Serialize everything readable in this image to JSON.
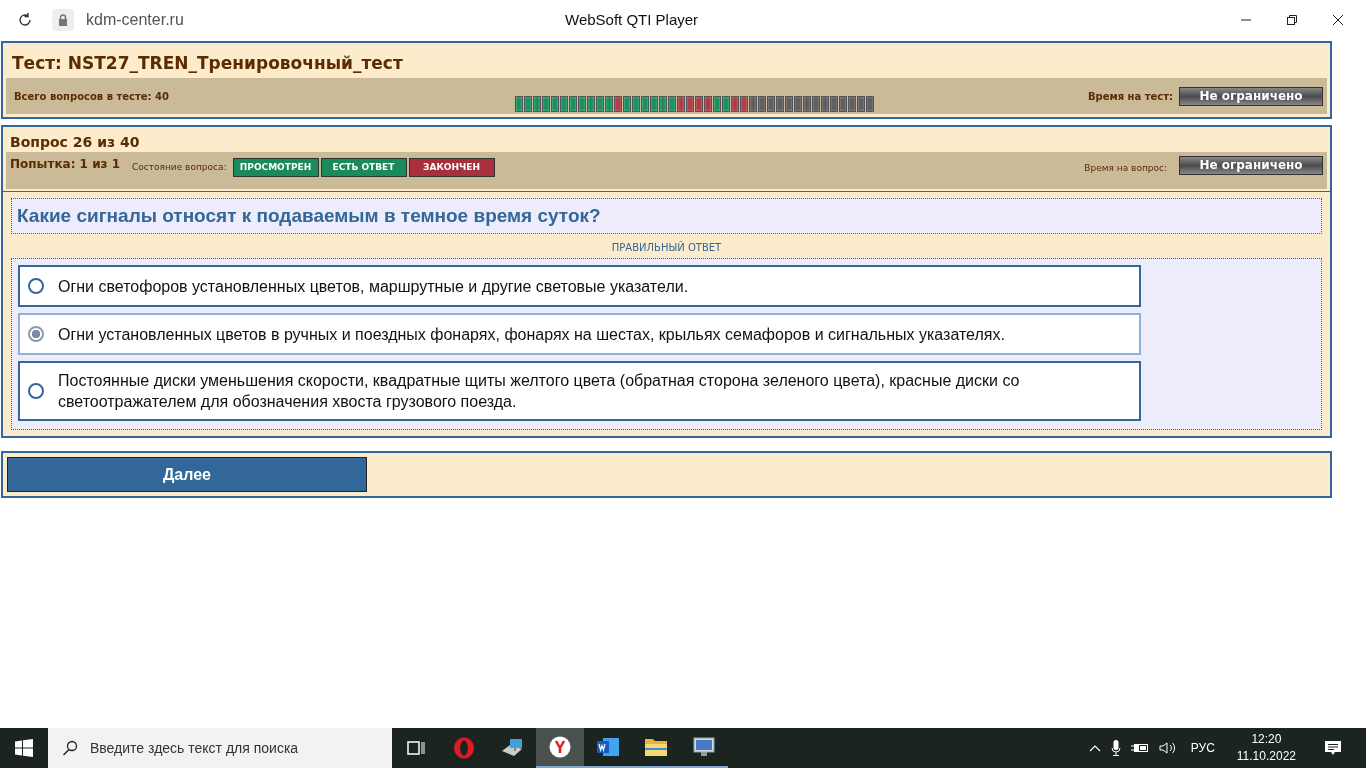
{
  "browser": {
    "url": "kdm-center.ru",
    "title": "WebSoft QTI Player"
  },
  "test": {
    "title": "Тест: NST27_TREN_Тренировочный_тест",
    "total_label": "Всего вопросов в тесте: 40",
    "time_label": "Время на тест:",
    "time_value": "Не ограничено",
    "progress": [
      {
        "color": "#17925f"
      },
      {
        "color": "#17925f"
      },
      {
        "color": "#17925f"
      },
      {
        "color": "#17925f"
      },
      {
        "color": "#17925f"
      },
      {
        "color": "#17925f"
      },
      {
        "color": "#17925f"
      },
      {
        "color": "#17925f"
      },
      {
        "color": "#17925f"
      },
      {
        "color": "#17925f"
      },
      {
        "color": "#17925f"
      },
      {
        "color": "#b03a45"
      },
      {
        "color": "#17925f"
      },
      {
        "color": "#17925f"
      },
      {
        "color": "#17925f"
      },
      {
        "color": "#17925f"
      },
      {
        "color": "#17925f"
      },
      {
        "color": "#17925f"
      },
      {
        "color": "#b03a45"
      },
      {
        "color": "#b03a45"
      },
      {
        "color": "#b03a45"
      },
      {
        "color": "#b03a45"
      },
      {
        "color": "#17925f"
      },
      {
        "color": "#17925f"
      },
      {
        "color": "#b03a45"
      },
      {
        "color": "#b03a45"
      },
      {
        "color": "#5e5e5e"
      },
      {
        "color": "#5e5e5e"
      },
      {
        "color": "#5e5e5e"
      },
      {
        "color": "#5e5e5e"
      },
      {
        "color": "#5e5e5e"
      },
      {
        "color": "#5e5e5e"
      },
      {
        "color": "#5e5e5e"
      },
      {
        "color": "#5e5e5e"
      },
      {
        "color": "#5e5e5e"
      },
      {
        "color": "#5e5e5e"
      },
      {
        "color": "#5e5e5e"
      },
      {
        "color": "#5e5e5e"
      },
      {
        "color": "#5e5e5e"
      },
      {
        "color": "#5e5e5e"
      }
    ]
  },
  "question": {
    "title": "Вопрос 26 из 40",
    "attempt": "Попытка: 1 из 1",
    "state_label": "Состояние вопроса:",
    "states": [
      {
        "label": "ПРОСМОТРЕН",
        "color": "#1a8a5a"
      },
      {
        "label": "ЕСТЬ ОТВЕТ",
        "color": "#1a8a5a"
      },
      {
        "label": "ЗАКОНЧЕН",
        "color": "#a8303c"
      }
    ],
    "time_label": "Время на вопрос:",
    "time_value": "Не ограничено",
    "text": "Какие сигналы относят к подаваемым в темное время суток?",
    "answer_label": "ПРАВИЛЬНЫЙ ОТВЕТ",
    "options": [
      {
        "text": "Огни светофоров установленных цветов, маршрутные и другие световые указатели.",
        "selected": false
      },
      {
        "text": "Огни установленных цветов в ручных и поездных фонарях, фонарях на шестах, крыльях семафоров и сигнальных указателях.",
        "selected": true
      },
      {
        "text": "Постоянные диски уменьшения скорости, квадратные щиты желтого цвета (обратная сторона зеленого цвета), красные диски со светоотражателем для обозначения хвоста грузового поезда.",
        "selected": false
      }
    ]
  },
  "next_button": "Далее",
  "taskbar": {
    "search_placeholder": "Введите здесь текст для поиска",
    "apps": [
      {
        "kind": "taskview",
        "active": false,
        "running": false
      },
      {
        "kind": "opera",
        "active": false,
        "running": false
      },
      {
        "kind": "computer",
        "active": false,
        "running": false
      },
      {
        "kind": "yandex",
        "active": true,
        "running": true
      },
      {
        "kind": "word",
        "active": false,
        "running": true
      },
      {
        "kind": "folder",
        "active": false,
        "running": true
      },
      {
        "kind": "remote",
        "active": false,
        "running": true
      }
    ],
    "language": "РУС",
    "time": "12:20",
    "date": "11.10.2022"
  }
}
